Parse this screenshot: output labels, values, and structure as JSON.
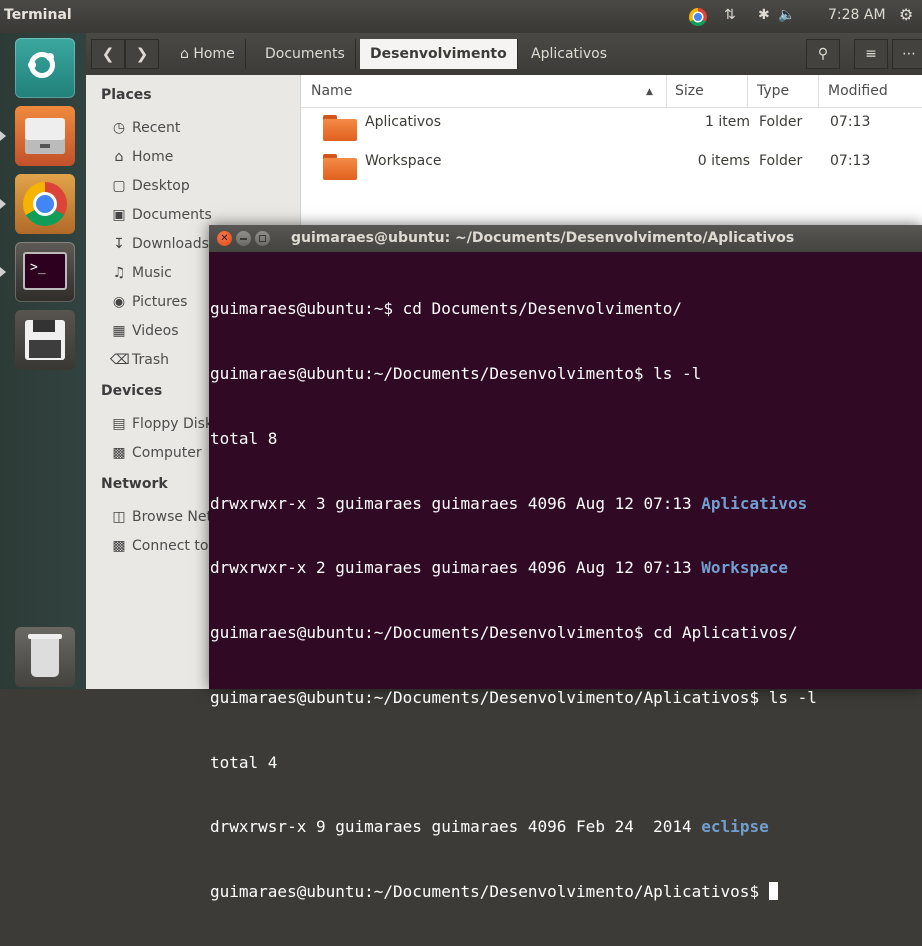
{
  "topbar": {
    "app_title": "Terminal",
    "time": "7:28 AM",
    "indicators": {
      "network": "⇅",
      "bluetooth": "✱",
      "volume": "🔈"
    }
  },
  "launcher": {
    "items": [
      "Ubuntu Dash",
      "Files",
      "Google Chrome",
      "Terminal",
      "Save",
      "Trash"
    ]
  },
  "files": {
    "path": [
      "Home",
      "Documents",
      "Desenvolvimento",
      "Aplicativos"
    ],
    "active_crumb": "Desenvolvimento",
    "sidebar": {
      "places_header": "Places",
      "places": [
        "Recent",
        "Home",
        "Desktop",
        "Documents",
        "Downloads",
        "Music",
        "Pictures",
        "Videos",
        "Trash"
      ],
      "devices_header": "Devices",
      "devices": [
        "Floppy Disk",
        "Computer"
      ],
      "network_header": "Network",
      "network": [
        "Browse Network",
        "Connect to Server"
      ]
    },
    "columns": {
      "name": "Name",
      "size": "Size",
      "type": "Type",
      "modified": "Modified"
    },
    "rows": [
      {
        "name": "Aplicativos",
        "size": "1 item",
        "type": "Folder",
        "modified": "07:13"
      },
      {
        "name": "Workspace",
        "size": "0 items",
        "type": "Folder",
        "modified": "07:13"
      }
    ]
  },
  "terminal": {
    "title": "guimaraes@ubuntu: ~/Documents/Desenvolvimento/Aplicativos",
    "lines": [
      {
        "text": "guimaraes@ubuntu:~$ cd Documents/Desenvolvimento/",
        "dir": ""
      },
      {
        "text": "guimaraes@ubuntu:~/Documents/Desenvolvimento$ ls -l",
        "dir": ""
      },
      {
        "text": "total 8",
        "dir": ""
      },
      {
        "text": "drwxrwxr-x 3 guimaraes guimaraes 4096 Aug 12 07:13 ",
        "dir": "Aplicativos"
      },
      {
        "text": "drwxrwxr-x 2 guimaraes guimaraes 4096 Aug 12 07:13 ",
        "dir": "Workspace"
      },
      {
        "text": "guimaraes@ubuntu:~/Documents/Desenvolvimento$ cd Aplicativos/",
        "dir": ""
      },
      {
        "text": "guimaraes@ubuntu:~/Documents/Desenvolvimento/Aplicativos$ ls -l",
        "dir": ""
      },
      {
        "text": "total 4",
        "dir": ""
      },
      {
        "text": "drwxrwsr-x 9 guimaraes guimaraes 4096 Feb 24  2014 ",
        "dir": "eclipse"
      },
      {
        "text": "guimaraes@ubuntu:~/Documents/Desenvolvimento/Aplicativos$ ",
        "dir": ""
      }
    ]
  }
}
